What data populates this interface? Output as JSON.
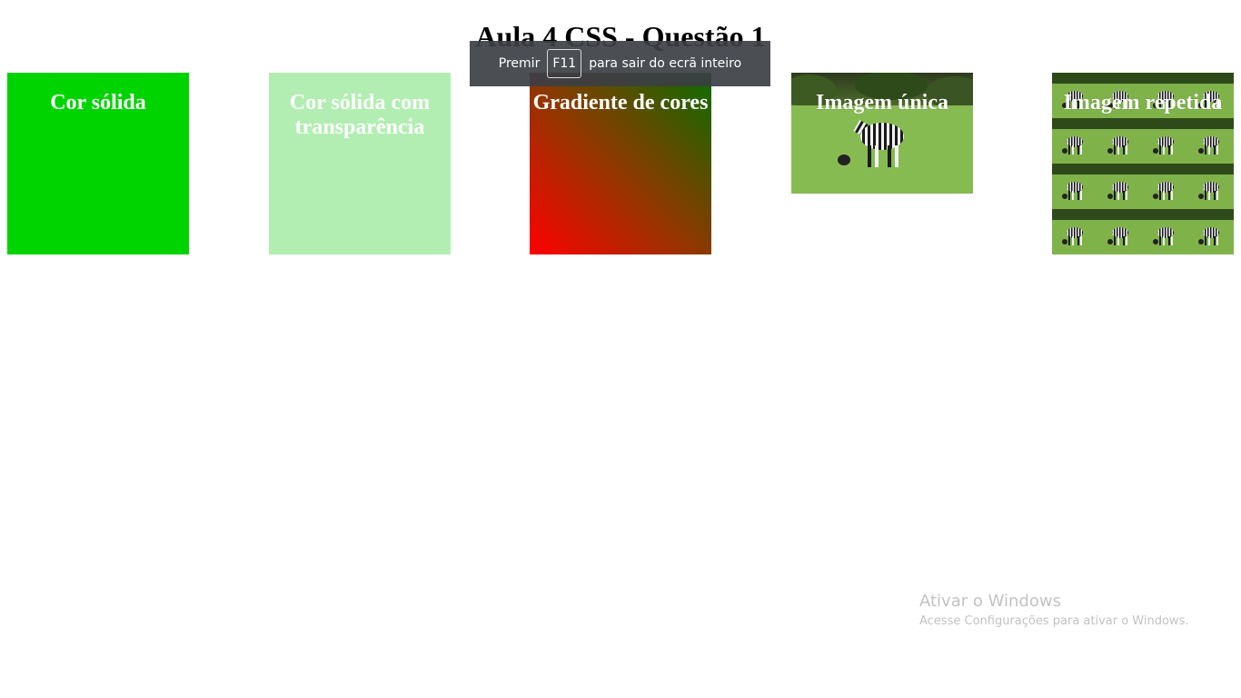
{
  "page": {
    "title": "Aula 4 CSS - Questão 1"
  },
  "boxes": [
    {
      "label": "Cor sólida",
      "color": "#00d400"
    },
    {
      "label": "Cor sólida com transparência",
      "color": "rgba(0,200,0,0.30)"
    },
    {
      "label": "Gradiente de cores",
      "colors": [
        "#ff0000",
        "#8a3a00",
        "#0b6e00"
      ]
    },
    {
      "label": "Imagem única",
      "image": "zebra-grazing"
    },
    {
      "label": "Imagem repetida",
      "image": "zebra-grazing-tiled"
    }
  ],
  "toast": {
    "prefix": "Premir",
    "key": "F11",
    "suffix": "para sair do ecrã inteiro"
  },
  "watermark": {
    "title": "Ativar o Windows",
    "subtitle": "Acesse Configurações para ativar o Windows."
  }
}
